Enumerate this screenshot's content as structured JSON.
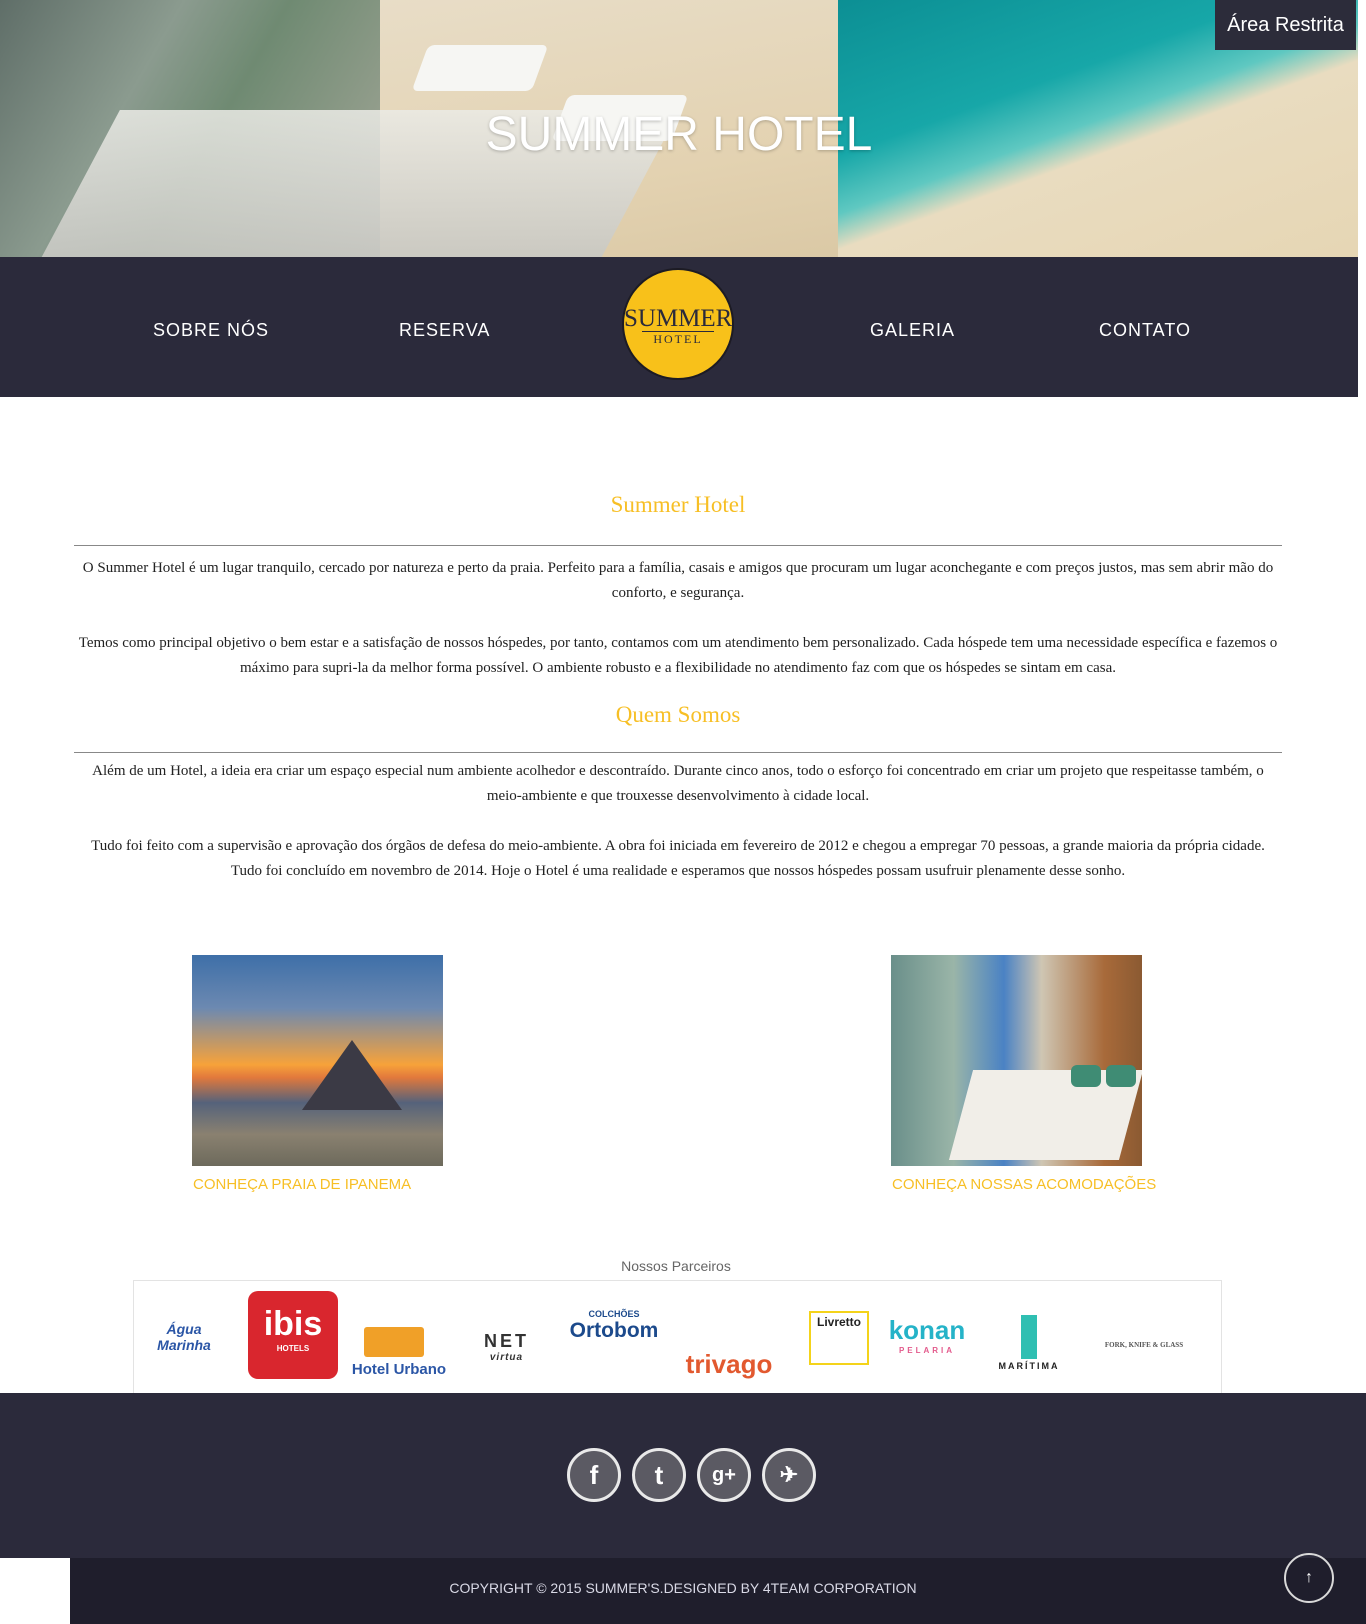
{
  "header": {
    "title": "SUMMER HOTEL",
    "restricted_area": "Área Restrita"
  },
  "nav": {
    "items": [
      "SOBRE NÓS",
      "RESERVA",
      "GALERIA",
      "CONTATO"
    ],
    "logo": {
      "line1": "SUMMER",
      "line2": "HOTEL"
    }
  },
  "about": {
    "title": "Summer Hotel",
    "paragraphs": [
      "O Summer Hotel é um lugar tranquilo, cercado por natureza e perto da praia.  Perfeito para a família, casais e amigos que procuram um lugar aconchegante e com preços justos, mas sem abrir mão do conforto, e segurança.",
      "Temos como principal objetivo o bem estar e a satisfação de nossos hóspedes, por tanto, contamos com um atendimento bem personalizado. Cada hóspede tem uma necessidade específica e fazemos o máximo para supri-la da melhor forma possível. O ambiente robusto e a flexibilidade no atendimento faz com que os hóspedes se sintam em casa."
    ]
  },
  "who": {
    "title": "Quem Somos",
    "paragraphs": [
      "Além de um Hotel, a ideia era criar um espaço especial num ambiente acolhedor e descontraído. Durante cinco anos, todo o esforço foi concentrado em criar um projeto que respeitasse também, o meio-ambiente e que trouxesse desenvolvimento à cidade local.",
      "Tudo foi feito com a supervisão e aprovação dos órgãos de defesa do meio-ambiente. A obra foi iniciada em fevereiro de 2012 e chegou a empregar 70 pessoas, a grande maioria da própria cidade. Tudo foi concluído em novembro de 2014. Hoje o Hotel é uma realidade e esperamos que nossos hóspedes possam usufruir plenamente desse sonho."
    ]
  },
  "links": {
    "ipanema": "CONHEÇA PRAIA DE IPANEMA",
    "rooms": "CONHEÇA NOSSAS ACOMODAÇÕES"
  },
  "partners": {
    "title": "Nossos Parceiros",
    "logos": [
      "Água Marinha",
      "ibis",
      "HOTELS",
      "Hotel Urbano",
      "NET",
      "virtua",
      "COLCHÕES",
      "Ortobom",
      "trivago",
      "Livretto",
      "konan",
      "PELARIA",
      "MARÍTIMA",
      "FORK, KNIFE & GLASS"
    ]
  },
  "footer": {
    "social": [
      "f",
      "t",
      "g+",
      "✈"
    ],
    "copyright": "COPYRIGHT © 2015 SUMMER'S.DESIGNED BY 4TEAM CORPORATION",
    "to_top": "↑"
  },
  "colors": {
    "accent": "#f7bf25",
    "nav_bg": "#2b2a3b",
    "footer_bg": "#1f1e2c"
  }
}
